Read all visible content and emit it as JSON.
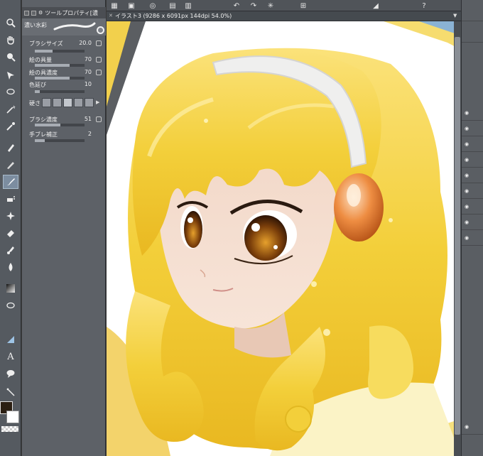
{
  "document": {
    "tab_title": "イラスト3 (9286 x 6091px 144dpi 54.0%)"
  },
  "tool_property": {
    "panel_title": "ツールプロパティ[濃",
    "brush_name": "濃い水彩",
    "properties": [
      {
        "label": "ブラシサイズ",
        "value": "20.0",
        "level": 0.35
      },
      {
        "label": "絵の具量",
        "value": "70",
        "level": 0.7
      },
      {
        "label": "絵の具濃度",
        "value": "70",
        "level": 0.7
      },
      {
        "label": "色延び",
        "value": "10",
        "level": 0.1
      },
      {
        "label": "硬さ",
        "value": ""
      },
      {
        "label": "ブラシ濃度",
        "value": "51",
        "level": 0.51
      },
      {
        "label": "手ブレ補正",
        "value": "2",
        "level": 0.2
      }
    ]
  },
  "colors": {
    "main_color": "#2b1f12",
    "sub_color": "#ffffff",
    "hair": "#f5d33c",
    "skin": "#f5dccf",
    "eye": "#6b3a0a",
    "clip": "#e07a32"
  },
  "tools": [
    "move-icon",
    "hand-icon",
    "zoom-icon",
    "select-icon",
    "lasso-icon",
    "eyedropper-icon",
    "pen-icon",
    "pencil-icon",
    "brush-icon",
    "airbrush-icon",
    "decoration-icon",
    "eraser-icon",
    "blend-icon",
    "fill-icon",
    "gradient-icon",
    "shape-icon",
    "ruler-icon",
    "text-icon",
    "balloon-icon",
    "correction-icon"
  ],
  "layers": {
    "visible_rows": 10
  }
}
